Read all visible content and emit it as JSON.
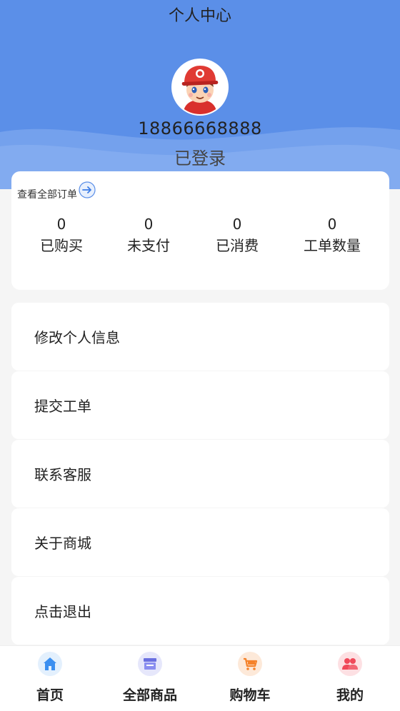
{
  "header": {
    "title": "个人中心",
    "phone": "18866668888",
    "status": "已登录"
  },
  "orders": {
    "view_all": "查看全部订单",
    "stats": [
      {
        "value": "0",
        "label": "已购买"
      },
      {
        "value": "0",
        "label": "未支付"
      },
      {
        "value": "0",
        "label": "已消费"
      },
      {
        "value": "0",
        "label": "工单数量"
      }
    ]
  },
  "menu": [
    {
      "label": "修改个人信息"
    },
    {
      "label": "提交工单"
    },
    {
      "label": "联系客服"
    },
    {
      "label": "关于商城"
    },
    {
      "label": "点击退出"
    }
  ],
  "tabbar": [
    {
      "label": "首页",
      "icon": "home-icon",
      "color": "#3b8ff0"
    },
    {
      "label": "全部商品",
      "icon": "store-icon",
      "color": "#6a6fe0"
    },
    {
      "label": "购物车",
      "icon": "cart-icon",
      "color": "#f5822a"
    },
    {
      "label": "我的",
      "icon": "users-icon",
      "color": "#f0495a"
    }
  ],
  "colors": {
    "header_bg": "#5b8fe8",
    "page_bg": "#f5f5f5"
  }
}
